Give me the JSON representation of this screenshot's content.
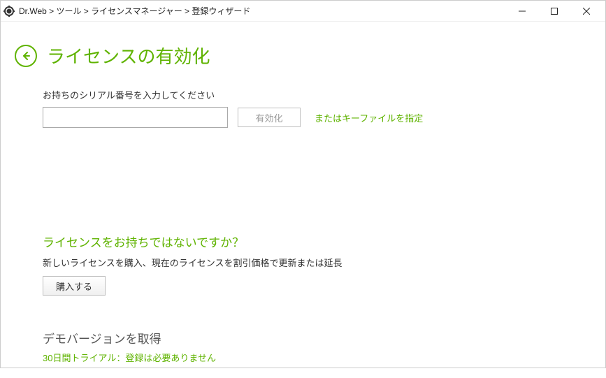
{
  "window": {
    "breadcrumb": "Dr.Web > ツール > ライセンスマネージャー > 登録ウィザード"
  },
  "main": {
    "title": "ライセンスの有効化",
    "serial_label": "お持ちのシリアル番号を入力してください",
    "activate_button": "有効化",
    "keyfile_link": "またはキーファイルを指定"
  },
  "no_license": {
    "heading": "ライセンスをお持ちではないですか？",
    "desc": "新しいライセンスを購入、現在のライセンスを割引価格で更新または延長",
    "buy_button": "購入する"
  },
  "demo": {
    "heading": "デモバージョンを取得",
    "link": "30日間トライアル：登録は必要ありません"
  }
}
